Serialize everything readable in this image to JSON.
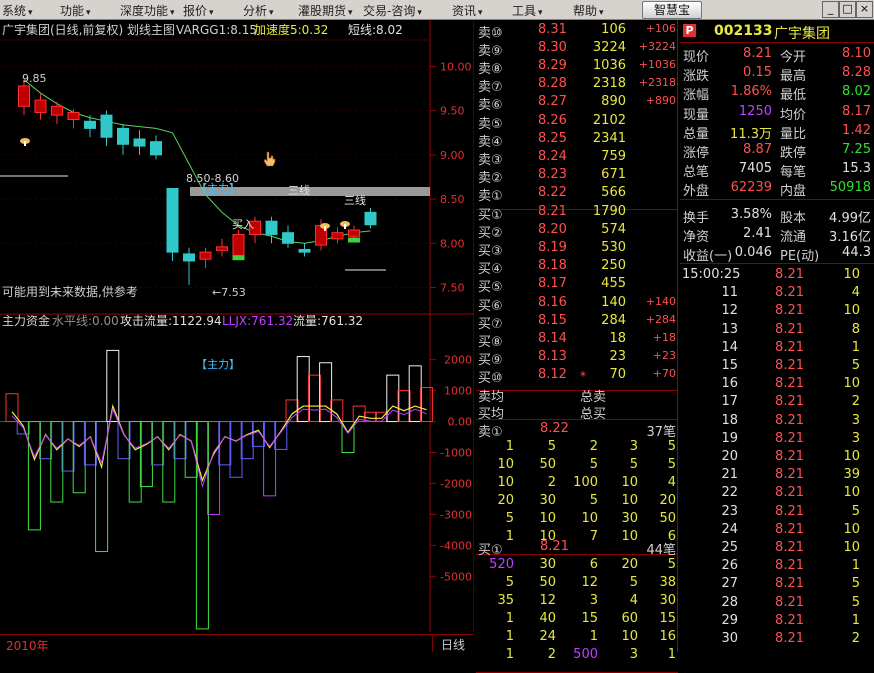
{
  "menu": [
    {
      "label": "系统",
      "x": 2
    },
    {
      "label": "功能",
      "x": 60
    },
    {
      "label": "深度功能",
      "x": 120
    },
    {
      "label": "报价",
      "x": 183
    },
    {
      "label": "分析",
      "x": 243
    },
    {
      "label": "灌股期货",
      "x": 298
    },
    {
      "label": "交易-咨询",
      "x": 363
    },
    {
      "label": "资讯",
      "x": 452
    },
    {
      "label": "工具",
      "x": 512
    },
    {
      "label": "帮助",
      "x": 573
    }
  ],
  "toolbar_button": "智慧宝",
  "win_buttons": [
    "_",
    "□",
    "×"
  ],
  "chart": {
    "title": "广宇集团(日线,前复权) 划线主图",
    "indicator": "VARGG1:8.15",
    "speed": "加速度5:0.32",
    "short_line": "短线:8.02",
    "price_ticks": [
      "10.00",
      "9.50",
      "9.00",
      "8.50",
      "8.00",
      "7.50"
    ],
    "high_label": "9.85",
    "low_label": "←7.53",
    "range_label": "8.50-8.60",
    "zhuli_tag": "【主力】",
    "sanxian_1": "三线",
    "sanxian_2": "三线",
    "buy_label": "买入",
    "warning": "可能用到未来数据,供参考",
    "sub_title": "主力资金",
    "sub_level": "水平线:0.00",
    "sub_attack": "攻击流量:1122.94",
    "sub_lljx": "LLJX:761.32",
    "sub_flow": "流量:761.32",
    "sub_zhuli": "【主力】",
    "sub_ticks": [
      "2000",
      "1000",
      "0.00",
      "-1000",
      "-2000",
      "-3000",
      "-4000",
      "-5000"
    ],
    "year": "2010年",
    "period": "日线"
  },
  "chart_data": {
    "type": "candlestick",
    "ylim": [
      7.2,
      10.3
    ],
    "candles": [
      {
        "o": 9.55,
        "c": 9.78,
        "h": 9.85,
        "l": 9.45
      },
      {
        "o": 9.48,
        "c": 9.62,
        "h": 9.7,
        "l": 9.4
      },
      {
        "o": 9.45,
        "c": 9.55,
        "h": 9.6,
        "l": 9.35
      },
      {
        "o": 9.4,
        "c": 9.48,
        "h": 9.52,
        "l": 9.3
      },
      {
        "o": 9.38,
        "c": 9.3,
        "h": 9.45,
        "l": 9.2
      },
      {
        "o": 9.45,
        "c": 9.2,
        "h": 9.5,
        "l": 9.1
      },
      {
        "o": 9.3,
        "c": 9.12,
        "h": 9.35,
        "l": 9.0
      },
      {
        "o": 9.18,
        "c": 9.1,
        "h": 9.28,
        "l": 9.0
      },
      {
        "o": 9.15,
        "c": 9.0,
        "h": 9.22,
        "l": 8.95
      },
      {
        "o": 8.62,
        "c": 7.9,
        "h": 8.6,
        "l": 7.8
      },
      {
        "o": 7.88,
        "c": 7.8,
        "h": 7.95,
        "l": 7.53
      },
      {
        "o": 7.82,
        "c": 7.9,
        "h": 7.95,
        "l": 7.72
      },
      {
        "o": 7.92,
        "c": 7.96,
        "h": 8.05,
        "l": 7.85
      },
      {
        "o": 7.85,
        "c": 8.1,
        "h": 8.15,
        "l": 7.82
      },
      {
        "o": 8.1,
        "c": 8.25,
        "h": 8.3,
        "l": 8.0
      },
      {
        "o": 8.25,
        "c": 8.1,
        "h": 8.3,
        "l": 8.0
      },
      {
        "o": 8.12,
        "c": 8.0,
        "h": 8.2,
        "l": 7.95
      },
      {
        "o": 7.93,
        "c": 7.9,
        "h": 8.0,
        "l": 7.85
      },
      {
        "o": 7.98,
        "c": 8.2,
        "h": 8.27,
        "l": 7.92
      },
      {
        "o": 8.05,
        "c": 8.12,
        "h": 8.18,
        "l": 8.0
      },
      {
        "o": 8.08,
        "c": 8.15,
        "h": 8.2,
        "l": 8.02
      },
      {
        "o": 8.35,
        "c": 8.21,
        "h": 8.4,
        "l": 8.17
      }
    ],
    "ma": [
      9.85,
      9.7,
      9.58,
      9.48,
      9.42,
      9.38,
      9.34,
      9.32,
      9.3,
      9.25,
      8.9,
      8.55,
      8.35,
      8.2,
      8.12,
      8.08,
      8.02,
      8.0,
      8.03,
      8.08,
      8.12,
      8.14
    ],
    "sub_ylim": [
      -6800,
      2700
    ],
    "sub_bars": [
      {
        "v": 900,
        "c": "red"
      },
      {
        "v": -400,
        "c": "blue"
      },
      {
        "v": -3500,
        "c": "green"
      },
      {
        "v": -1200,
        "c": "blue"
      },
      {
        "v": -2600,
        "c": "green"
      },
      {
        "v": -1600,
        "c": "blue"
      },
      {
        "v": -2300,
        "c": "green"
      },
      {
        "v": -1400,
        "c": "blue"
      },
      {
        "v": -4200,
        "c": "green"
      },
      {
        "v": 2300,
        "c": "white"
      },
      {
        "v": -1200,
        "c": "blue"
      },
      {
        "v": -2600,
        "c": "green"
      },
      {
        "v": -2100,
        "c": "green"
      },
      {
        "v": -1400,
        "c": "blue"
      },
      {
        "v": -2600,
        "c": "green"
      },
      {
        "v": -1200,
        "c": "blue"
      },
      {
        "v": -1800,
        "c": "green"
      },
      {
        "v": -6700,
        "c": "green"
      },
      {
        "v": -3000,
        "c": "purple"
      },
      {
        "v": -1400,
        "c": "blue"
      },
      {
        "v": -1800,
        "c": "blue"
      },
      {
        "v": -1200,
        "c": "blue"
      },
      {
        "v": -800,
        "c": "blue"
      },
      {
        "v": -2400,
        "c": "purple"
      },
      {
        "v": -900,
        "c": "blue"
      },
      {
        "v": 700,
        "c": "red"
      },
      {
        "v": 2100,
        "c": "white"
      },
      {
        "v": 1500,
        "c": "red"
      },
      {
        "v": 1900,
        "c": "white"
      },
      {
        "v": 700,
        "c": "red"
      },
      {
        "v": -1000,
        "c": "green"
      },
      {
        "v": 500,
        "c": "red"
      },
      {
        "v": 300,
        "c": "red"
      },
      {
        "v": 300,
        "c": "red"
      },
      {
        "v": 1500,
        "c": "white"
      },
      {
        "v": 1000,
        "c": "red"
      },
      {
        "v": 1800,
        "c": "white"
      },
      {
        "v": 1100,
        "c": "red"
      }
    ]
  },
  "book": {
    "sell": [
      {
        "label": "卖⑩",
        "price": "8.31",
        "vol": "106",
        "chg": "+106"
      },
      {
        "label": "卖⑨",
        "price": "8.30",
        "vol": "3224",
        "chg": "+3224"
      },
      {
        "label": "卖⑧",
        "price": "8.29",
        "vol": "1036",
        "chg": "+1036"
      },
      {
        "label": "卖⑦",
        "price": "8.28",
        "vol": "2318",
        "chg": "+2318"
      },
      {
        "label": "卖⑥",
        "price": "8.27",
        "vol": "890",
        "chg": "+890"
      },
      {
        "label": "卖⑤",
        "price": "8.26",
        "vol": "2102",
        "chg": ""
      },
      {
        "label": "卖④",
        "price": "8.25",
        "vol": "2341",
        "chg": ""
      },
      {
        "label": "卖③",
        "price": "8.24",
        "vol": "759",
        "chg": ""
      },
      {
        "label": "卖②",
        "price": "8.23",
        "vol": "671",
        "chg": ""
      },
      {
        "label": "卖①",
        "price": "8.22",
        "vol": "566",
        "chg": ""
      }
    ],
    "buy": [
      {
        "label": "买①",
        "price": "8.21",
        "vol": "1790",
        "chg": ""
      },
      {
        "label": "买②",
        "price": "8.20",
        "vol": "574",
        "chg": ""
      },
      {
        "label": "买③",
        "price": "8.19",
        "vol": "530",
        "chg": ""
      },
      {
        "label": "买④",
        "price": "8.18",
        "vol": "250",
        "chg": ""
      },
      {
        "label": "买⑤",
        "price": "8.17",
        "vol": "455",
        "chg": ""
      },
      {
        "label": "买⑥",
        "price": "8.16",
        "vol": "140",
        "chg": "+140"
      },
      {
        "label": "买⑦",
        "price": "8.15",
        "vol": "284",
        "chg": "+284"
      },
      {
        "label": "买⑧",
        "price": "8.14",
        "vol": "18",
        "chg": "+18"
      },
      {
        "label": "买⑨",
        "price": "8.13",
        "vol": "23",
        "chg": "+23"
      },
      {
        "label": "买⑩",
        "price": "8.12",
        "vol": "70",
        "chg": "+70"
      }
    ],
    "avg_sell_label": "卖均",
    "total_sell_label": "总卖",
    "avg_buy_label": "买均",
    "total_buy_label": "总买",
    "queue_sell": {
      "label": "卖①",
      "price": "8.22",
      "count": "37笔",
      "rows": [
        [
          "1",
          "5",
          "2",
          "3",
          "5"
        ],
        [
          "10",
          "50",
          "5",
          "5",
          "5"
        ],
        [
          "10",
          "2",
          "100",
          "10",
          "4"
        ],
        [
          "20",
          "30",
          "5",
          "10",
          "20"
        ],
        [
          "5",
          "10",
          "10",
          "30",
          "50"
        ],
        [
          "1",
          "10",
          "7",
          "10",
          "6"
        ]
      ]
    },
    "queue_buy": {
      "label": "买①",
      "price": "8.21",
      "count": "44笔",
      "rows": [
        [
          "520",
          "30",
          "6",
          "20",
          "5"
        ],
        [
          "5",
          "50",
          "12",
          "5",
          "38"
        ],
        [
          "35",
          "12",
          "3",
          "4",
          "30"
        ],
        [
          "1",
          "40",
          "15",
          "60",
          "15"
        ],
        [
          "1",
          "24",
          "1",
          "10",
          "16"
        ],
        [
          "1",
          "2",
          "500",
          "3",
          "1"
        ]
      ]
    }
  },
  "quote": {
    "badge": "P",
    "code": "002133",
    "name": "广宇集团",
    "rows": [
      {
        "l1": "现价",
        "v1": "8.21",
        "c1": "red",
        "l2": "今开",
        "v2": "8.10",
        "c2": "red"
      },
      {
        "l1": "涨跌",
        "v1": "0.15",
        "c1": "red",
        "l2": "最高",
        "v2": "8.28",
        "c2": "red"
      },
      {
        "l1": "涨幅",
        "v1": "1.86%",
        "c1": "red",
        "l2": "最低",
        "v2": "8.02",
        "c2": "green"
      },
      {
        "l1": "现量",
        "v1": "1250",
        "c1": "purple",
        "l2": "均价",
        "v2": "8.17",
        "c2": "red"
      },
      {
        "l1": "总量",
        "v1": "11.3万",
        "c1": "yellow",
        "l2": "量比",
        "v2": "1.42",
        "c2": "red"
      },
      {
        "l1": "涨停",
        "v1": "8.87",
        "c1": "red",
        "l2": "跌停",
        "v2": "7.25",
        "c2": "green"
      },
      {
        "l1": "总笔",
        "v1": "7405",
        "c1": "white",
        "l2": "每笔",
        "v2": "15.3",
        "c2": "white"
      },
      {
        "l1": "外盘",
        "v1": "62239",
        "c1": "red",
        "l2": "内盘",
        "v2": "50918",
        "c2": "green"
      },
      {
        "l1": "换手",
        "v1": "3.58%",
        "c1": "white",
        "l2": "股本",
        "v2": "4.99亿",
        "c2": "white"
      },
      {
        "l1": "净资",
        "v1": "2.41",
        "c1": "white",
        "l2": "流通",
        "v2": "3.16亿",
        "c2": "white"
      },
      {
        "l1": "收益(一)",
        "v1": "0.046",
        "c1": "white",
        "l2": "PE(动)",
        "v2": "44.3",
        "c2": "white"
      }
    ],
    "ticks": [
      {
        "t": "15:00:25",
        "p": "8.21",
        "v": "10"
      },
      {
        "t": "11",
        "p": "8.21",
        "v": "4"
      },
      {
        "t": "12",
        "p": "8.21",
        "v": "10"
      },
      {
        "t": "13",
        "p": "8.21",
        "v": "8"
      },
      {
        "t": "14",
        "p": "8.21",
        "v": "1"
      },
      {
        "t": "15",
        "p": "8.21",
        "v": "5"
      },
      {
        "t": "16",
        "p": "8.21",
        "v": "10"
      },
      {
        "t": "17",
        "p": "8.21",
        "v": "2"
      },
      {
        "t": "18",
        "p": "8.21",
        "v": "3"
      },
      {
        "t": "19",
        "p": "8.21",
        "v": "3"
      },
      {
        "t": "20",
        "p": "8.21",
        "v": "10"
      },
      {
        "t": "21",
        "p": "8.21",
        "v": "39"
      },
      {
        "t": "22",
        "p": "8.21",
        "v": "10"
      },
      {
        "t": "23",
        "p": "8.21",
        "v": "5"
      },
      {
        "t": "24",
        "p": "8.21",
        "v": "10"
      },
      {
        "t": "25",
        "p": "8.21",
        "v": "10"
      },
      {
        "t": "26",
        "p": "8.21",
        "v": "1"
      },
      {
        "t": "27",
        "p": "8.21",
        "v": "5"
      },
      {
        "t": "28",
        "p": "8.21",
        "v": "5"
      },
      {
        "t": "29",
        "p": "8.21",
        "v": "1"
      },
      {
        "t": "30",
        "p": "8.21",
        "v": "2"
      }
    ]
  }
}
